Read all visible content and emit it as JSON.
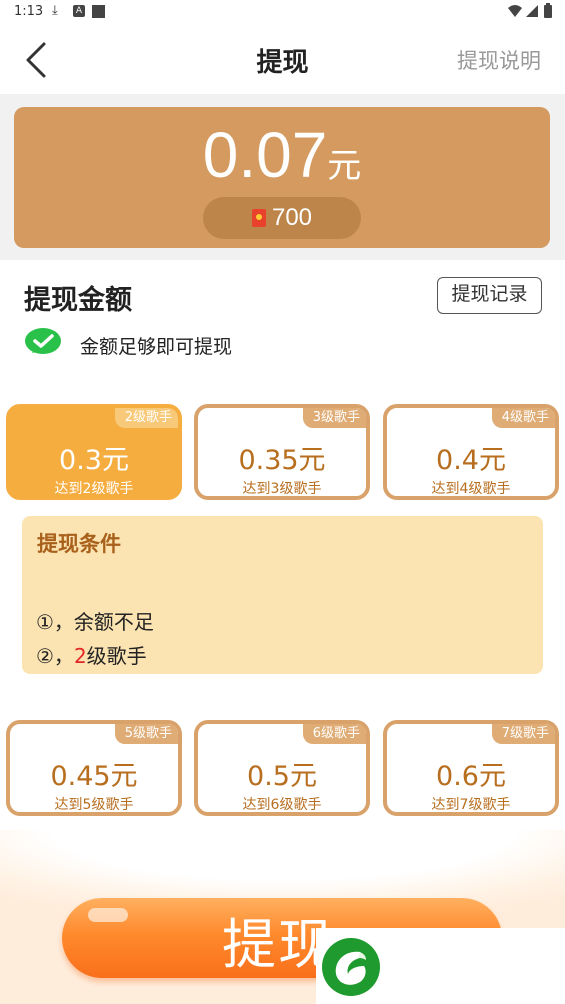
{
  "status_bar": {
    "time": "1:13",
    "icons": [
      "download-icon",
      "a-box-icon",
      "square-icon",
      "wifi-icon",
      "signal-icon",
      "battery-icon"
    ]
  },
  "nav": {
    "back_icon": "chevron-left-icon",
    "title": "提现",
    "right_link": "提现说明"
  },
  "balance": {
    "amount": "0.07",
    "unit": "元",
    "coins": "700",
    "card_color": "#d49a5f"
  },
  "section": {
    "title": "提现金额",
    "records_button": "提现记录",
    "note": "金额足够即可提现"
  },
  "tiers_top": [
    {
      "badge": "2级歌手",
      "amount": "0.3元",
      "requirement": "达到2级歌手",
      "selected": true
    },
    {
      "badge": "3级歌手",
      "amount": "0.35元",
      "requirement": "达到3级歌手",
      "selected": false
    },
    {
      "badge": "4级歌手",
      "amount": "0.4元",
      "requirement": "达到4级歌手",
      "selected": false
    }
  ],
  "conditions": {
    "title": "提现条件",
    "item1": "①，余额不足",
    "item2_prefix": "②，",
    "item2_highlight": "2",
    "item2_suffix": "级歌手"
  },
  "tiers_bottom": [
    {
      "badge": "5级歌手",
      "amount": "0.45元",
      "requirement": "达到5级歌手",
      "selected": false
    },
    {
      "badge": "6级歌手",
      "amount": "0.5元",
      "requirement": "达到6级歌手",
      "selected": false
    },
    {
      "badge": "7级歌手",
      "amount": "0.6元",
      "requirement": "达到7级歌手",
      "selected": false
    }
  ],
  "withdraw_button": {
    "label": "提现"
  },
  "colors": {
    "accent": "#f6ad3f",
    "tier_border": "#d8a26a",
    "button": "#ff8a2d",
    "highlight": "#e62626"
  }
}
